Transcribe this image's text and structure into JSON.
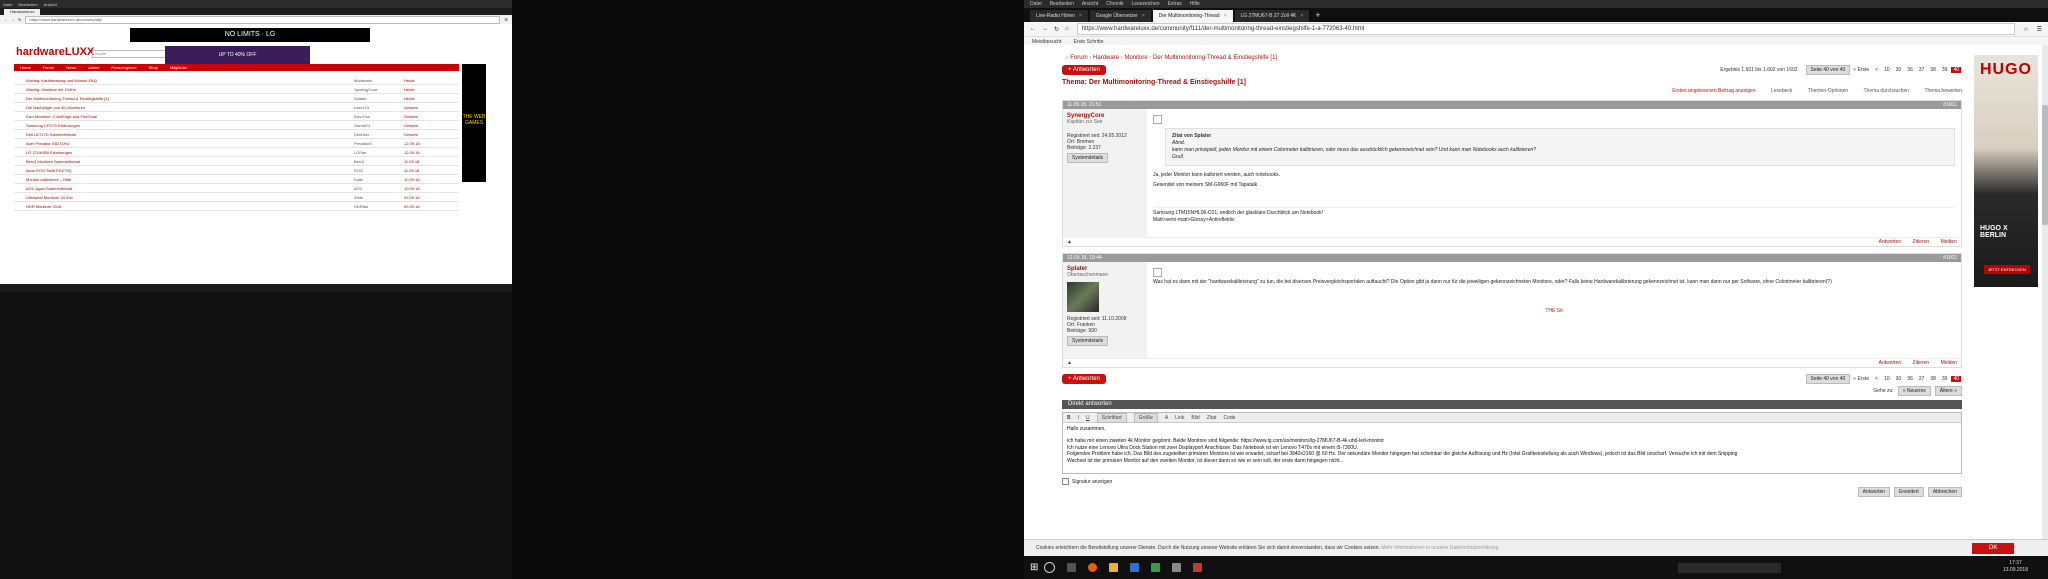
{
  "left": {
    "top_menu": [
      "Datei",
      "Bearbeiten",
      "Ansicht"
    ],
    "tab_label": "Hardwareluxx",
    "url": "https://www.hardwareluxx.de/community/",
    "logo": "hardwareLUXX",
    "search_placeholder": "Suche",
    "banner": "NO LIMITS · LG",
    "promo": "UP TO 40% OFF",
    "menu": [
      "Home",
      "Forum",
      "News",
      "Artikel",
      "Preisvergleich",
      "Shop",
      "Mitglieder"
    ],
    "threads": [
      {
        "title": "Wichtig: Kaufberatung und Monitor-FAQ",
        "start": "Moderator",
        "last": "Heute"
      },
      {
        "title": "Wichtig: Monitore mit 144Hz",
        "start": "SynergyCore",
        "last": "Heute"
      },
      {
        "title": "Der Multimonitoring-Thread & Einstiegshilfe [1]",
        "start": "Splater",
        "last": "Heute"
      },
      {
        "title": "Die Nachfolger von 4K-Monitoren",
        "start": "User123",
        "last": "Gestern"
      },
      {
        "title": "Eizo Monitore: ColorEdge und FlexScan",
        "start": "Eizo-Fan",
        "last": "Gestern"
      },
      {
        "title": "Samsung CFG70 Erfahrungen",
        "start": "Gamer01",
        "last": "Gestern"
      },
      {
        "title": "Dell U2717D Sammelthread",
        "start": "DellUser",
        "last": "Gestern"
      },
      {
        "title": "Acer Predator XB271HU",
        "start": "PredatorX",
        "last": "12.09.18"
      },
      {
        "title": "LG 27UK850 Erfahrungen",
        "start": "LGFan",
        "last": "12.09.18"
      },
      {
        "title": "BenQ Monitore Sammelthread",
        "start": "BenQ",
        "last": "11.09.18"
      },
      {
        "title": "Asus ROG Swift PG279Q",
        "start": "ROG",
        "last": "11.09.18"
      },
      {
        "title": "Monitor kalibrieren – Hilfe",
        "start": "Kalib",
        "last": "10.09.18"
      },
      {
        "title": "AOC Agon Sammelthread",
        "start": "AOC",
        "last": "10.09.18"
      },
      {
        "title": "Ultrawide Monitore 34 Zoll",
        "start": "Wide",
        "last": "09.09.18"
      },
      {
        "title": "HDR Monitore 2018",
        "start": "HDRfan",
        "last": "09.09.18"
      }
    ],
    "side_ad": "THE WEB GAMES"
  },
  "right": {
    "top_menu": [
      "Datei",
      "Bearbeiten",
      "Ansicht",
      "Chronik",
      "Lesezeichen",
      "Extras",
      "Hilfe"
    ],
    "tabs": [
      {
        "label": "Live-Radio Hören",
        "active": false
      },
      {
        "label": "Google Übersetzer",
        "active": false
      },
      {
        "label": "Der Multimonitoring-Thread",
        "active": true
      },
      {
        "label": "LG 27MU67-B 27 Zoll 4K",
        "active": false
      }
    ],
    "url": "https://www.hardwareluxx.de/community/f111/der-multimonitoring-thread-einstiegshilfe-1-a-772063-40.html",
    "bookmarks": [
      "Meistbesucht",
      "Erste Schritte"
    ],
    "breadcrumb": [
      "Forum",
      "Hardware",
      "Monitore",
      "Der Multimonitoring-Thread & Einstiegshilfe [1]"
    ],
    "reply_button": "+ Antworten",
    "results": "Ergebnis 1.601 bis 1.602 von 1602",
    "pagination": {
      "label": "Seite 40 von 40",
      "first": "« Erste",
      "prev": "<",
      "pages": [
        "10",
        "30",
        "36",
        "37",
        "38",
        "39",
        "40"
      ],
      "current": "40"
    },
    "thread_title": "Thema: Der Multimonitoring-Thread & Einstiegshilfe [1]",
    "thread_tools": [
      "Ersten ungelesenen Beitrag anzeigen",
      "Lesebeck",
      "Themen-Optionen",
      "Thema durchsuchen",
      "Thema bewerten"
    ],
    "posts": [
      {
        "date": "11.09.18, 21:51",
        "num": "#1601",
        "user": "SynergyCore",
        "rank": "Kapitän zur See",
        "registered": "Registriert seit: 24.05.2012",
        "location": "Ort: Bremen",
        "postcount": "Beiträge: 3.237",
        "badge": "Systemdetails",
        "quote_head": "Zitat von Splater",
        "quote_lines": [
          "Abnd.",
          "kann man prinzipiell, jeden Monitor mit einem Colormeter kalibrieren, oder muss das ausdrücklich gekennzeichnet sein? Und kann man Notebooks auch kalibrieren?",
          "Gruß"
        ],
        "lines": [
          "Ja, jeder Monitor kann kalibriert werden, auch notebooks.",
          "Gesendet von meinem SM-G960F mit Tapatalk"
        ],
        "sig": [
          "Samsung LTM15NHL06-C01, endlich der glasklare Durchblick am Notebook!",
          "Matt>semi-matt>Glossy>Antireflektiv"
        ]
      },
      {
        "date": "12.09.18, 18:44",
        "num": "#1602",
        "user": "Splater",
        "rank": "Obertaschenmann",
        "registered": "Registriert seit: 11.10.2009",
        "location": "Ort: Franken",
        "postcount": "Beiträge: 990",
        "badge": "Systemdetails",
        "lines": [
          "Was hat es dann mit der \"hardwarekalibrierung\" zu tun, die bei diversen Preisvergleichsportalen auftaucht? Die Option gibt ja dann nur für die jeweiligen gekennzeichneten Monitore, oder? Falls keine Hardwarekalibrierung gekennzeichnet ist, kann man dann nur per Software, ohne Colorimeter kalibrieren(?)"
        ],
        "sig_red": "THE Sti"
      }
    ],
    "post_actions": [
      "Antworten",
      "Zitieren",
      "Melden"
    ],
    "goto_label": "Gehe zu:",
    "goto_next": "« Neueres",
    "goto_prev": "Ältere »",
    "reply_title": "Direkt antworten",
    "toolbar": [
      "B",
      "I",
      "U",
      "Schriftart",
      "Größe",
      "A",
      "Link",
      "Bild",
      "Zitat",
      "Code"
    ],
    "editor_lines": [
      "Hallo zusammen,",
      "",
      "ich habe mir einen zweiten 4k Monitor gegönnt. Beide Monitore sind folgende: https://www.lg.com/us/monitors/lg-27MU67-B-4k-uhd-led-monitor",
      "Ich nutze eine Lenovo Ultra Dock Station mit zwei Displayport Anschlüsse. Das Notebook ist ein Lenovo T470s mit einem i5-7300U.",
      "Folgendes Problem habe ich. Das Bild des zugeteilten primären Monitors ist wie erwartet, scharf bei 3840x2160 @ 60 Hz. Der sekundäre Monitor hingegen hat scheinbar die gleiche Auflösung und Hz (Intel Grafikeinstellung als auch Windows), jedoch ist das Bild unscharf. Versuche ich mit dem Snipping",
      "Wechsel ist der primären Monitor auf den zweiten Monitor, ist dieser dann so wie er sein soll, der erste dann hingegen nicht..."
    ],
    "signature_label": "Signatur anzeigen",
    "submit_buttons": [
      "Antworten",
      "Erweitert",
      "Abbrechen"
    ],
    "ad": {
      "brand": "HUGO",
      "line1": "HUGO X",
      "line2": "BERLIN",
      "cta": "JETZT ENTDECKEN"
    },
    "cookie_text": "Cookies erleichtern die Bereitstellung unserer Dienste. Durch die Nutzung unserer Website erklären Sie sich damit einverstanden, dass wir Cookies setzen.",
    "cookie_more": "Mehr Informationen in unserer Datenschutzerklärung",
    "cookie_ok": "OK",
    "taskbar_search": "",
    "clock_time": "17:37",
    "clock_date": "13.09.2018"
  },
  "colors": {
    "brand": "#c81010",
    "link": "#9a1010"
  }
}
